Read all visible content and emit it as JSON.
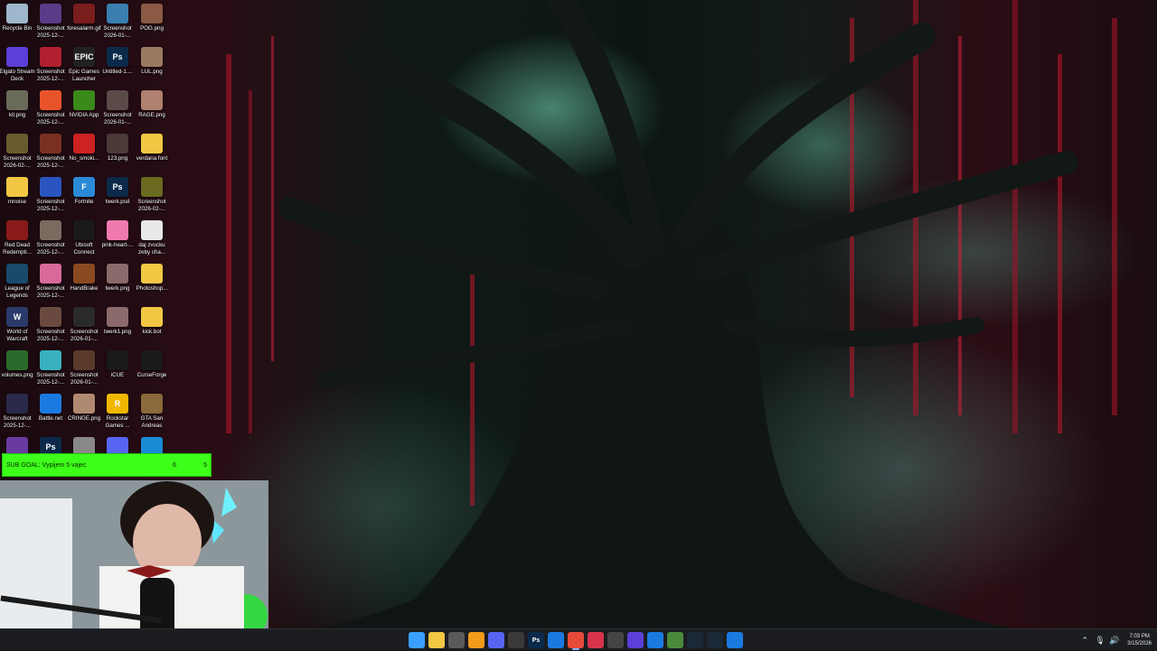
{
  "desktop": {
    "icons": [
      {
        "label": "Recycle Bin",
        "icon": "recycle-bin-icon",
        "color": "#9fb7cc"
      },
      {
        "label": "Screenshot 2025-12-...",
        "icon": "image-icon",
        "color": "#5b3a8a"
      },
      {
        "label": "foresalarm.gif",
        "icon": "image-icon",
        "color": "#7a1d1d"
      },
      {
        "label": "Screenshot 2026-01-...",
        "icon": "image-icon",
        "color": "#3a7fb0"
      },
      {
        "label": "POG.png",
        "icon": "image-icon",
        "color": "#8a5a45"
      },
      {
        "label": "Elgato Stream Deck",
        "icon": "stream-deck-icon",
        "color": "#5b3fd6"
      },
      {
        "label": "Screenshot 2025-12-...",
        "icon": "image-icon",
        "color": "#b02030"
      },
      {
        "label": "Epic Games Launcher",
        "icon": "epic-games-icon",
        "color": "#222222",
        "glyph": "EPIC"
      },
      {
        "label": "Untitled-1....",
        "icon": "photoshop-icon",
        "color": "#0b2a4a",
        "glyph": "Ps"
      },
      {
        "label": "LUL.png",
        "icon": "image-icon",
        "color": "#9a7a60"
      },
      {
        "label": "kit.png",
        "icon": "image-icon",
        "color": "#6a6a5a"
      },
      {
        "label": "Screenshot 2025-12-...",
        "icon": "firefox-icon",
        "color": "#e8542a"
      },
      {
        "label": "NVIDIA App",
        "icon": "nvidia-icon",
        "color": "#3a8a1a"
      },
      {
        "label": "Screenshot 2026-01-...",
        "icon": "image-icon",
        "color": "#5a4a48"
      },
      {
        "label": "RAGE.png",
        "icon": "image-icon",
        "color": "#b08070"
      },
      {
        "label": "Screenshot 2026-02-...",
        "icon": "image-icon",
        "color": "#6a5a30"
      },
      {
        "label": "Screenshot 2025-12-...",
        "icon": "image-icon",
        "color": "#7a3020"
      },
      {
        "label": "No_smoki...",
        "icon": "no-smoking-icon",
        "color": "#cc2222"
      },
      {
        "label": "123.png",
        "icon": "image-icon",
        "color": "#4a3a38"
      },
      {
        "label": "verdana font",
        "icon": "folder-icon",
        "color": "#f2c744"
      },
      {
        "label": "mnoise",
        "icon": "folder-icon",
        "color": "#f2c744"
      },
      {
        "label": "Screenshot 2025-12-...",
        "icon": "image-icon",
        "color": "#2a55c0"
      },
      {
        "label": "Fortnite",
        "icon": "fortnite-icon",
        "color": "#2a8ad6",
        "glyph": "F"
      },
      {
        "label": "twerk.psd",
        "icon": "photoshop-icon",
        "color": "#0b2a4a",
        "glyph": "Ps"
      },
      {
        "label": "Screenshot 2026-02-...",
        "icon": "image-icon",
        "color": "#6a6a20"
      },
      {
        "label": "Red Dead Redempti...",
        "icon": "game-icon",
        "color": "#8a1a1a"
      },
      {
        "label": "Screenshot 2025-12-...",
        "icon": "image-icon",
        "color": "#7a6a60"
      },
      {
        "label": "Ubisoft Connect",
        "icon": "ubisoft-icon",
        "color": "#1a1a1a"
      },
      {
        "label": "pink-heart-...",
        "icon": "heart-icon",
        "color": "#f07ab0"
      },
      {
        "label": "daj zvucku zeby cha...",
        "icon": "document-icon",
        "color": "#e8e8e8"
      },
      {
        "label": "League of Legends",
        "icon": "league-icon",
        "color": "#1a4a6a"
      },
      {
        "label": "Screenshot 2025-12-...",
        "icon": "image-icon",
        "color": "#d86a9a"
      },
      {
        "label": "HandBrake",
        "icon": "handbrake-icon",
        "color": "#8a4a20"
      },
      {
        "label": "twerk.png",
        "icon": "image-icon",
        "color": "#8a6a6a"
      },
      {
        "label": "Photoshop...",
        "icon": "folder-icon",
        "color": "#f2c744"
      },
      {
        "label": "World of Warcraft",
        "icon": "wow-icon",
        "color": "#2a3a6a",
        "glyph": "W"
      },
      {
        "label": "Screenshot 2025-12-...",
        "icon": "image-icon",
        "color": "#6a4a40"
      },
      {
        "label": "Screenshot 2026-01-...",
        "icon": "image-icon",
        "color": "#2a2a2a"
      },
      {
        "label": "twerk1.png",
        "icon": "image-icon",
        "color": "#8a6a6a"
      },
      {
        "label": "kick.bot",
        "icon": "folder-icon",
        "color": "#f2c744"
      },
      {
        "label": "volumes.png",
        "icon": "image-icon",
        "color": "#2a6a2a"
      },
      {
        "label": "Screenshot 2025-12-...",
        "icon": "image-icon",
        "color": "#3ab0c0"
      },
      {
        "label": "Screenshot 2026-01-...",
        "icon": "image-icon",
        "color": "#5a3a2a"
      },
      {
        "label": "iCUE",
        "icon": "icue-icon",
        "color": "#1a1a1a"
      },
      {
        "label": "CurseForge",
        "icon": "curseforge-icon",
        "color": "#1a1a1a"
      },
      {
        "label": "Screenshot 2025-12-...",
        "icon": "image-icon",
        "color": "#2a2a4a"
      },
      {
        "label": "Battle.net",
        "icon": "battlenet-icon",
        "color": "#1a7ae0"
      },
      {
        "label": "CRINGE.png",
        "icon": "image-icon",
        "color": "#b08a70"
      },
      {
        "label": "Rockstar Games ...",
        "icon": "rockstar-icon",
        "color": "#f2b800",
        "glyph": "R"
      },
      {
        "label": "GTA San Andreas",
        "icon": "game-icon",
        "color": "#8a6a3a"
      },
      {
        "label": "",
        "icon": "app-icon",
        "color": "#6a3aa0"
      },
      {
        "label": "",
        "icon": "photoshop-icon",
        "color": "#0b2a4a",
        "glyph": "Ps"
      },
      {
        "label": "",
        "icon": "app-icon",
        "color": "#888888"
      },
      {
        "label": "",
        "icon": "discord-icon",
        "color": "#5865f2"
      },
      {
        "label": "",
        "icon": "app-icon",
        "color": "#1a8ad6"
      }
    ]
  },
  "sub_goal": {
    "text": "SUB GOAL: Vypijem 5 vajec",
    "current": "6",
    "target": "5"
  },
  "taskbar": {
    "apps": [
      {
        "name": "start",
        "icon": "windows-start-icon",
        "color": "#3aa0ff"
      },
      {
        "name": "file-explorer",
        "icon": "folder-icon",
        "color": "#f2c744"
      },
      {
        "name": "app",
        "icon": "app-icon",
        "color": "#5a5a5a"
      },
      {
        "name": "app",
        "icon": "app-icon",
        "color": "#f29a1a"
      },
      {
        "name": "discord",
        "icon": "discord-icon",
        "color": "#5865f2"
      },
      {
        "name": "app",
        "icon": "app-icon",
        "color": "#3a3a3a"
      },
      {
        "name": "photoshop",
        "icon": "photoshop-icon",
        "color": "#0b2a4a",
        "glyph": "Ps"
      },
      {
        "name": "battlenet",
        "icon": "battlenet-icon",
        "color": "#1a7ae0"
      },
      {
        "name": "chrome",
        "icon": "chrome-icon",
        "color": "#e84a3a",
        "active": true
      },
      {
        "name": "app",
        "icon": "app-icon",
        "color": "#d8334a"
      },
      {
        "name": "app",
        "icon": "app-icon",
        "color": "#444444"
      },
      {
        "name": "stream-deck",
        "icon": "stream-deck-icon",
        "color": "#5b3fd6"
      },
      {
        "name": "app",
        "icon": "app-icon",
        "color": "#1a7ae0"
      },
      {
        "name": "app",
        "icon": "app-icon",
        "color": "#4a8a3a"
      },
      {
        "name": "steam",
        "icon": "steam-icon",
        "color": "#1b2838"
      },
      {
        "name": "steam",
        "icon": "steam-icon",
        "color": "#1b2838"
      },
      {
        "name": "battlenet",
        "icon": "battlenet-icon",
        "color": "#1a7ae0"
      }
    ],
    "tray": {
      "icons": [
        "chevron-up-icon",
        "microphone-icon",
        "volume-icon"
      ],
      "time": "7:03 PM",
      "date": "3/15/2026"
    }
  }
}
